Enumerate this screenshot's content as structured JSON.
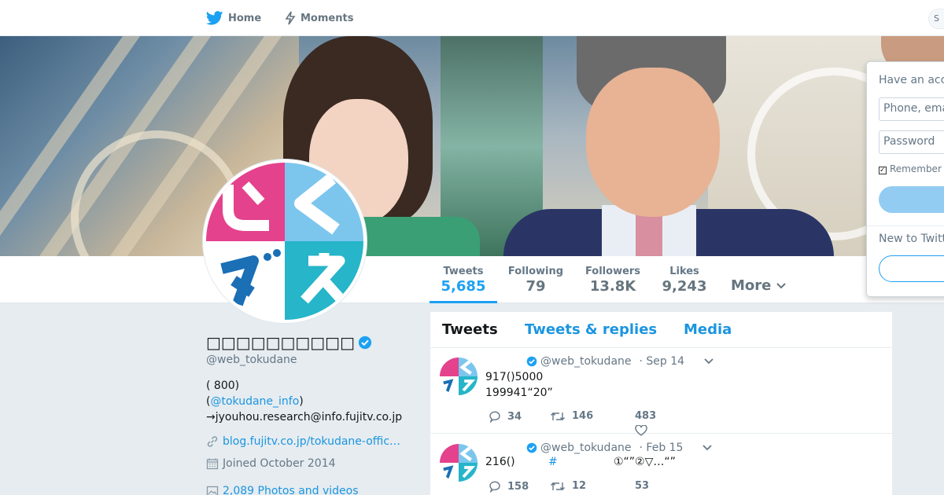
{
  "nav": {
    "home_label": "Home",
    "moments_label": "Moments",
    "search_placeholder": "S"
  },
  "profile": {
    "name": "□□□□□□□□□□",
    "screen_name": "@web_tokudane",
    "bio_line1": "( 800)",
    "bio_line2_open": "(",
    "bio_mention": "@tokudane_info",
    "bio_line2_close": ")",
    "bio_line3": "→jyouhou.research@info.fujitv.co.jp",
    "website": "blog.fujitv.co.jp/tokudane-offic…",
    "joined": "Joined October 2014",
    "photos": "2,089 Photos and videos"
  },
  "stats": {
    "tweets_label": "Tweets",
    "tweets_value": "5,685",
    "following_label": "Following",
    "following_value": "79",
    "followers_label": "Followers",
    "followers_value": "13.8K",
    "likes_label": "Likes",
    "likes_value": "9,243",
    "more_label": "More"
  },
  "timeline": {
    "tabs": [
      "Tweets",
      "Tweets & replies",
      "Media"
    ],
    "tweets": [
      {
        "handle": "@web_tokudane",
        "date": "· Sep 14",
        "line1": "917()5000",
        "line2": "199941“20”",
        "replies": "34",
        "retweets": "146",
        "likes": "483"
      },
      {
        "handle": "@web_tokudane",
        "date": "· Feb 15",
        "line1": "216()",
        "hashtag": "#",
        "line1_tail": "①“”②▽…“”",
        "replies": "158",
        "retweets": "12",
        "likes": "53"
      }
    ]
  },
  "login": {
    "title": "Have an acco",
    "phone_placeholder": "Phone, emai",
    "password_placeholder": "Password",
    "remember_label": "Remember",
    "new_to_twitter": "New to Twitt"
  },
  "colors": {
    "accent": "#1da1f2",
    "link": "#1b95e0",
    "muted": "#657786",
    "background": "#e6ecf0",
    "logo_pink": "#e4428c",
    "logo_lightblue": "#7cc6ee",
    "logo_blue": "#1a6fb5",
    "logo_teal": "#26b5c9"
  },
  "icons": [
    "twitter-bird-icon",
    "lightning-icon",
    "verified-badge-icon",
    "link-icon",
    "calendar-icon",
    "photo-icon",
    "chevron-down-icon",
    "reply-icon",
    "retweet-icon",
    "heart-icon"
  ]
}
